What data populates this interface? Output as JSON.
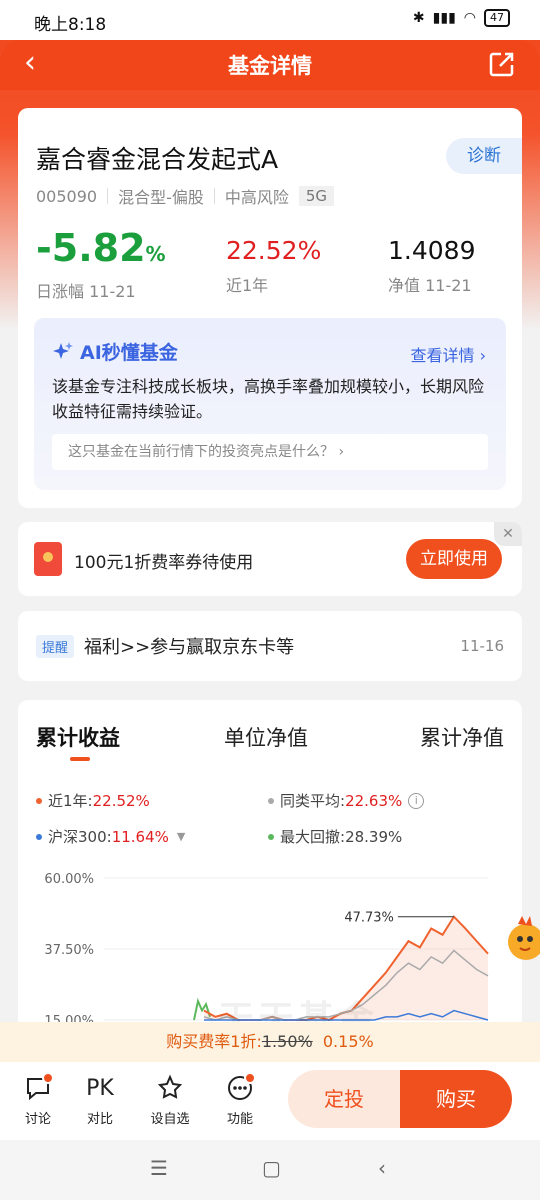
{
  "status": {
    "time": "晚上8:18",
    "battery": "47"
  },
  "nav": {
    "title": "基金详情"
  },
  "fund": {
    "name": "嘉合睿金混合发起式A",
    "diagnose_label": "诊断",
    "code": "005090",
    "type": "混合型-偏股",
    "risk": "中高风险",
    "tag": "5G",
    "day_change": "-5.82",
    "day_change_unit": "%",
    "day_change_label": "日涨幅 11-21",
    "year_return": "22.52%",
    "year_return_label": "近1年",
    "nav_value": "1.4089",
    "nav_label": "净值 11-21"
  },
  "ai": {
    "title": "AI秒懂基金",
    "more": "查看详情 ›",
    "text": "该基金专注科技成长板块，高换手率叠加规模较小，长期风险收益特征需持续验证。",
    "question": "这只基金在当前行情下的投资亮点是什么？ ›"
  },
  "coupon": {
    "text": "100元1折费率券待使用",
    "button": "立即使用",
    "close": "✕"
  },
  "remind": {
    "tag": "提醒",
    "text": "福利>>参与赢取京东卡等",
    "date": "11-16"
  },
  "chart_tabs": [
    "累计收益",
    "单位净值",
    "累计净值"
  ],
  "legend": {
    "fund_label": "近1年:",
    "fund_value": "22.52%",
    "avg_label": "同类平均:",
    "avg_value": "22.63%",
    "index_label": "沪深300:",
    "index_value": "11.64%",
    "drawdown_label": "最大回撤:",
    "drawdown_value": "28.39%"
  },
  "watermark": "天天基金",
  "colors": {
    "fund": "#f0622e",
    "avg": "#aaaaaa",
    "index": "#3b7ad8",
    "green": "#5cb85c"
  },
  "chart_data": {
    "type": "line",
    "y_ticks": [
      "60.00%",
      "37.50%",
      "15.00%"
    ],
    "peak_label": "47.73%",
    "ylim": [
      15,
      60
    ],
    "series": [
      {
        "name": "近1年",
        "values": [
          18,
          16,
          17,
          15,
          14,
          15,
          16,
          15,
          14,
          15,
          16,
          15,
          17,
          18,
          22,
          26,
          30,
          35,
          40,
          38,
          44,
          42,
          47.73,
          44,
          40,
          36
        ]
      },
      {
        "name": "同类平均",
        "values": [
          16,
          15,
          16,
          15,
          15,
          15,
          16,
          15,
          15,
          16,
          16,
          16,
          17,
          18,
          20,
          23,
          26,
          30,
          33,
          31,
          35,
          33,
          37,
          34,
          31,
          29
        ]
      },
      {
        "name": "沪深300",
        "values": [
          15,
          14,
          14,
          13,
          13,
          13,
          14,
          13,
          13,
          14,
          14,
          14,
          14,
          14,
          15,
          15,
          16,
          16,
          17,
          16,
          17,
          16,
          18,
          17,
          16,
          15
        ]
      }
    ]
  },
  "fee": {
    "prefix": "购买费率1折:",
    "old": "1.50%",
    "new": "0.15%"
  },
  "bottom": {
    "discuss": "讨论",
    "compare": "对比",
    "compare_icon": "PK",
    "watch": "设自选",
    "func": "功能",
    "invest": "定投",
    "buy": "购买"
  },
  "sysnav": {
    "menu": "☰",
    "home": "▢",
    "back": "‹"
  }
}
